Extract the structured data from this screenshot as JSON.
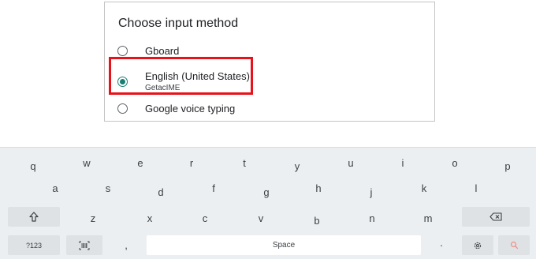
{
  "dialog": {
    "title": "Choose input method",
    "options": [
      {
        "label": "Gboard",
        "sub": "",
        "selected": false
      },
      {
        "label": "English (United States)",
        "sub": "GetacIME",
        "selected": true
      },
      {
        "label": "Google voice typing",
        "sub": "",
        "selected": false
      }
    ]
  },
  "keyboard": {
    "row1": [
      "q",
      "w",
      "e",
      "r",
      "t",
      "y",
      "u",
      "i",
      "o",
      "p"
    ],
    "row2": [
      "a",
      "s",
      "d",
      "f",
      "g",
      "h",
      "j",
      "k",
      "l"
    ],
    "row3": [
      "z",
      "x",
      "c",
      "v",
      "b",
      "n",
      "m"
    ],
    "symbols_label": "?123",
    "comma_label": ",",
    "space_label": "Space",
    "period_label": "·",
    "icons": {
      "shift": "shift-icon",
      "backspace": "backspace-icon",
      "barcode": "barcode-icon",
      "settings": "gear-icon",
      "search": "search-icon"
    }
  },
  "colors": {
    "accent": "#1a7f73",
    "highlight": "#e8121b",
    "keyboard_bg": "#eceff1",
    "search_icon": "#f28b82"
  }
}
